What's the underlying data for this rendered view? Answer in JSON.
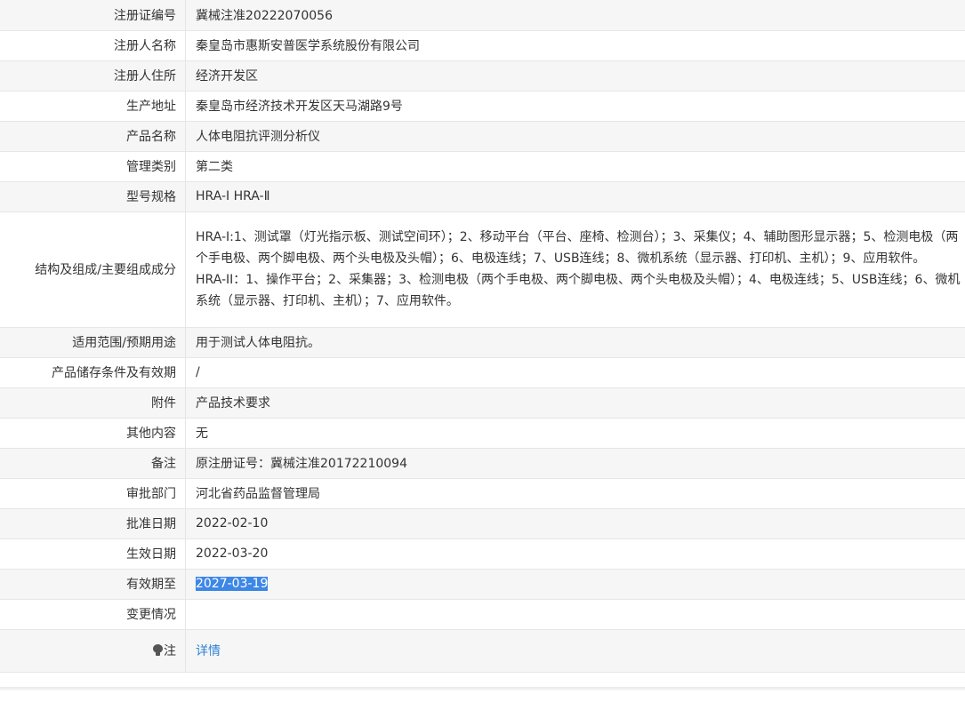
{
  "rows": [
    {
      "label": "注册证编号",
      "value": "冀械注准20222070056"
    },
    {
      "label": "注册人名称",
      "value": "秦皇岛市惠斯安普医学系统股份有限公司"
    },
    {
      "label": "注册人住所",
      "value": "经济开发区"
    },
    {
      "label": "生产地址",
      "value": "秦皇岛市经济技术开发区天马湖路9号"
    },
    {
      "label": "产品名称",
      "value": "人体电阻抗评测分析仪"
    },
    {
      "label": "管理类别",
      "value": "第二类"
    },
    {
      "label": "型号规格",
      "value": "HRA-I HRA-Ⅱ"
    },
    {
      "label": "结构及组成/主要组成成分",
      "value_line1": "HRA-I:1、测试罩（灯光指示板、测试空间环）；2、移动平台（平台、座椅、检测台）；3、采集仪；4、辅助图形显示器；5、检测电极（两个手电极、两个脚电极、两个头电极及头帽）；6、电极连线；7、USB连线；8、微机系统（显示器、打印机、主机）；9、应用软件。",
      "value_line2": "HRA-II：1、操作平台；2、采集器；3、检测电极（两个手电极、两个脚电极、两个头电极及头帽）；4、电极连线；5、USB连线；6、微机系统（显示器、打印机、主机）；7、应用软件。"
    },
    {
      "label": "适用范围/预期用途",
      "value": "用于测试人体电阻抗。"
    },
    {
      "label": "产品储存条件及有效期",
      "value": "/"
    },
    {
      "label": "附件",
      "value": "产品技术要求"
    },
    {
      "label": "其他内容",
      "value": "无"
    },
    {
      "label": "备注",
      "value": "原注册证号：冀械注准20172210094"
    },
    {
      "label": "审批部门",
      "value": "河北省药品监督管理局"
    },
    {
      "label": "批准日期",
      "value": "2022-02-10"
    },
    {
      "label": "生效日期",
      "value": "2022-03-20"
    },
    {
      "label": "有效期至",
      "value": "2027-03-19"
    },
    {
      "label": "变更情况",
      "value": ""
    },
    {
      "label": "注",
      "value": "详情"
    }
  ],
  "icons": {
    "note_icon": "lightbulb-icon"
  },
  "colors": {
    "stripe": "#f6f6f6",
    "border": "#e6e6e6",
    "link": "#2f83d6",
    "selection": "#3d87e6"
  }
}
